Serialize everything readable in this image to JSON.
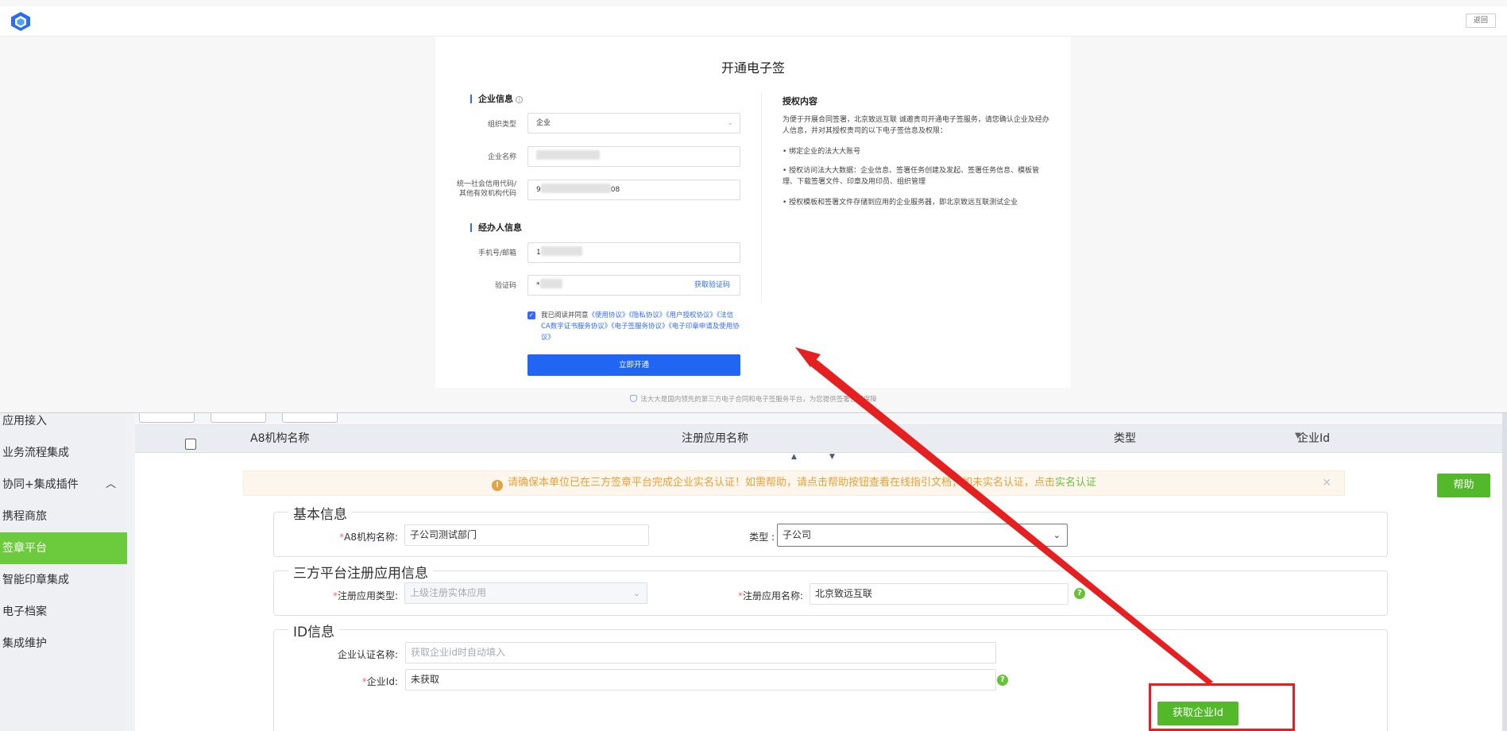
{
  "popup": {
    "back_label": "返回",
    "title": "开通电子签",
    "company_section": "企业信息",
    "org_type_label": "组织类型",
    "org_type_value": "企业",
    "company_name_label": "企业名称",
    "credit_code_label_1": "统一社会信用代码/",
    "credit_code_label_2": "其他有效机构代码",
    "credit_code_prefix": "9",
    "credit_code_suffix": "08",
    "handler_section": "经办人信息",
    "phone_label": "手机号/邮箱",
    "phone_prefix": "1",
    "code_label": "验证码",
    "code_prefix": "*",
    "get_code_link": "获取验证码",
    "agree_prefix": "我已阅读并同意",
    "agree_links": "《使用协议》《隐私协议》《用户授权协议》《法信CA数字证书服务协议》《电子签服务协议》《电子印章申请及使用协议》",
    "open_button": "立即开通",
    "auth_title": "授权内容",
    "auth_intro": "为便于开展合同签署，北京致远互联 诚邀贵司开通电子签服务，请您确认企业及经办人信息，并对其授权贵司的以下电子签信息及权限：",
    "auth_item_1": "• 绑定企业的法大大账号",
    "auth_item_2": "• 授权访问法大大数据：企业信息、签署任务创建及发起、签署任务信息、模板管理、下载签署文件、印章及用印员、组织管理",
    "auth_item_3": "• 授权模板和签署文件存储到应用的企业服务器，即北京致远互联测试企业",
    "footer_note": "法大大是国内领先的第三方电子合同和电子签服务平台，为您提供签署合规保障"
  },
  "sidebar": {
    "items": [
      {
        "label": "应用接入"
      },
      {
        "label": "业务流程集成"
      },
      {
        "label": "协同+集成插件"
      },
      {
        "label": "携程商旅"
      },
      {
        "label": "签章平台"
      },
      {
        "label": "智能印章集成"
      },
      {
        "label": "电子档案"
      },
      {
        "label": "集成维护"
      }
    ],
    "chevron": "︿"
  },
  "table": {
    "columns": [
      "A8机构名称",
      "注册应用名称",
      "类型",
      "企业Id"
    ]
  },
  "warning": {
    "text": "请确保本单位已在三方签章平台完成企业实名认证！如需帮助，请点击帮助按钮查看在线指引文档；如未实名认证，点击",
    "link": "实名认证",
    "close": "✕"
  },
  "help_button": "帮助",
  "form": {
    "basic": {
      "legend": "基本信息",
      "org_label": "A8机构名称:",
      "org_value": "子公司测试部门",
      "type_label": "类型 :",
      "type_value": "子公司"
    },
    "thirdparty": {
      "legend": "三方平台注册应用信息",
      "reg_type_label": "注册应用类型:",
      "reg_type_value": "上级注册实体应用",
      "reg_name_label": "注册应用名称:",
      "reg_name_value": "北京致远互联"
    },
    "id_info": {
      "legend": "ID信息",
      "cert_name_label": "企业认证名称:",
      "cert_name_placeholder": "获取企业id时自动填入",
      "ent_id_label": "企业Id:",
      "ent_id_value": "未获取",
      "get_id_button": "获取企业Id"
    },
    "required_mark": "*",
    "help_mark": "?"
  },
  "colors": {
    "accent_green": "#53b82a",
    "primary_blue": "#2166f3",
    "warning": "#e6a23c",
    "highlight_red": "#e52020"
  }
}
